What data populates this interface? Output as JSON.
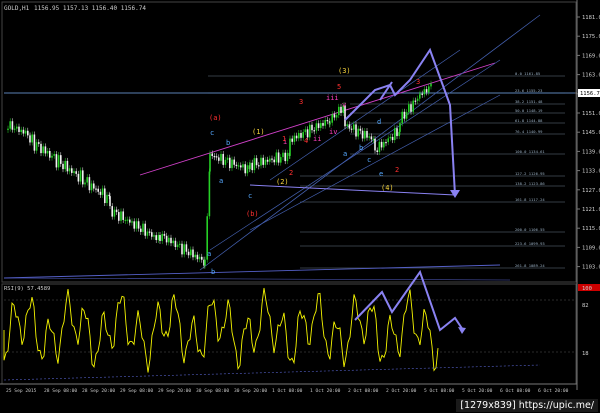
{
  "chart": {
    "symbol": "GOLD,H1",
    "ohlc": "1156.95 1157.13 1156.40 1156.74",
    "current_price": "1156.74",
    "colors": {
      "bull": "#26d126",
      "bear": "#f2f2f2",
      "bg": "#000000",
      "rsi": "#f5f500",
      "arrow": "#8a82f2",
      "wave_yellow": "#f5d33c",
      "wave_red": "#ff3030",
      "wave_blue": "#55a8ff",
      "wave_magenta": "#ff40c0"
    },
    "rsi_label": "RSI(9) 57.4589"
  },
  "price_axis": [
    "1181.05",
    "1175.05",
    "1169.05",
    "1163.05",
    "1157.05",
    "1151.05",
    "1145.05",
    "1139.05",
    "1133.05",
    "1127.05",
    "1121.05",
    "1115.05",
    "1109.05",
    "1103.05"
  ],
  "rsi_axis": [
    "100",
    "82",
    "18"
  ],
  "time_axis": [
    "25 Sep 2015",
    "28 Sep 08:00",
    "28 Sep 20:00",
    "29 Sep 08:00",
    "29 Sep 20:00",
    "30 Sep 08:00",
    "30 Sep 20:00",
    "1 Oct 08:00",
    "1 Oct 20:00",
    "2 Oct 08:00",
    "2 Oct 20:00",
    "5 Oct 08:00",
    "5 Oct 20:00",
    "6 Oct 08:00",
    "6 Oct 20:00"
  ],
  "fib_labels": [
    "0.0 1161.85",
    "23.6 1155.23",
    "38.2 1151.48",
    "50.0 1148.19",
    "61.8 1144.88",
    "76.4 1140.99",
    "100.0 1134.61",
    "127.2 1126.95",
    "138.2 1123.86",
    "161.8 1117.24",
    "200.0 1106.55",
    "223.6 1099.93",
    "261.8 1089.24"
  ],
  "waves": [
    "(3)",
    "(a)",
    "(b)",
    "(2)",
    "(4)",
    "(1)",
    "a",
    "b",
    "c",
    "d",
    "e",
    "i",
    "ii",
    "iii",
    "iv",
    "v",
    "1",
    "2",
    "3",
    "4",
    "5"
  ],
  "watermark": "[1279x839] https://upic.me/"
}
